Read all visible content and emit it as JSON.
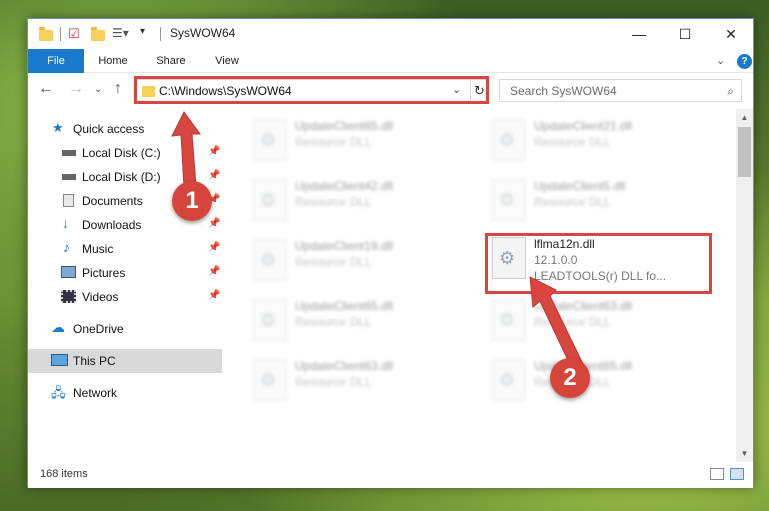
{
  "window": {
    "title": "SysWOW64",
    "minimize": "—",
    "maximize": "☐",
    "close": "✕"
  },
  "ribbon": {
    "tabs": [
      "File",
      "Home",
      "Share",
      "View"
    ],
    "help": "?"
  },
  "address": {
    "path": "C:\\Windows\\SysWOW64",
    "search_placeholder": "Search SysWOW64"
  },
  "sidebar": {
    "items": [
      {
        "label": "Quick access",
        "icon": "star-icon",
        "pinned": false
      },
      {
        "label": "Local Disk (C:)",
        "icon": "drive-icon",
        "pinned": true
      },
      {
        "label": "Local Disk (D:)",
        "icon": "drive-icon",
        "pinned": true
      },
      {
        "label": "Documents",
        "icon": "documents-icon",
        "pinned": true
      },
      {
        "label": "Downloads",
        "icon": "download-arrow-icon",
        "pinned": true
      },
      {
        "label": "Music",
        "icon": "music-note-icon",
        "pinned": true
      },
      {
        "label": "Pictures",
        "icon": "pictures-icon",
        "pinned": true
      },
      {
        "label": "Videos",
        "icon": "film-icon",
        "pinned": true
      },
      {
        "label": "OneDrive",
        "icon": "cloud-icon",
        "pinned": false
      },
      {
        "label": "This PC",
        "icon": "monitor-icon",
        "pinned": false,
        "selected": true
      },
      {
        "label": "Network",
        "icon": "network-icon",
        "pinned": false
      }
    ]
  },
  "files": [
    {
      "name": "UpdateClient65.dll",
      "type": "Resource DLL"
    },
    {
      "name": "UpdateClient21.dll",
      "type": "Resource DLL"
    },
    {
      "name": "UpdateClient42.dll",
      "type": "Resource DLL"
    },
    {
      "name": "UpdateClient5.dll",
      "type": "Resource DLL"
    },
    {
      "name": "UpdateClient19.dll",
      "type": "Resource DLL"
    },
    {
      "name": "lflma12n.dll",
      "version": "12.1.0.0",
      "description": "LEADTOOLS(r) DLL fo..."
    },
    {
      "name": "UpdateClient65.dll",
      "type": "Resource DLL"
    },
    {
      "name": "UpdateClient63.dll",
      "type": "Resource DLL"
    },
    {
      "name": "UpdateClient63.dll",
      "type": "Resource DLL"
    },
    {
      "name": "UpdateClient65.dll",
      "type": "Resource DLL"
    }
  ],
  "status": {
    "item_count": "168 items"
  },
  "callouts": [
    "1",
    "2"
  ],
  "colors": {
    "accent": "#1979ca",
    "highlight": "#d9463f"
  }
}
